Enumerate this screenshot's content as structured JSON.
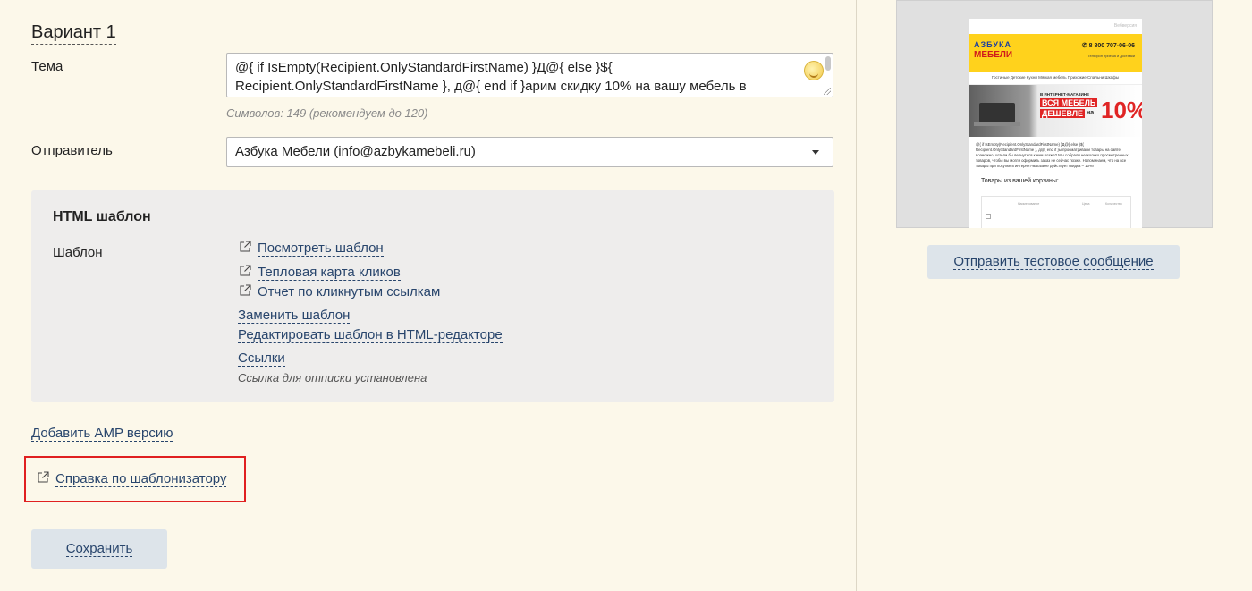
{
  "variant": {
    "title": "Вариант 1"
  },
  "subject": {
    "label": "Тема",
    "value": "@{ if IsEmpty(Recipient.OnlyStandardFirstName) }Д@{ else }${ Recipient.OnlyStandardFirstName }, д@{ end if }арим скидку 10% на вашу мебель в",
    "char_count": "Символов: 149 (рекомендуем до 120)"
  },
  "sender": {
    "label": "Отправитель",
    "value": "Азбука Мебели (info@azbykamebeli.ru)"
  },
  "html_template": {
    "title": "HTML шаблон",
    "template_label": "Шаблон",
    "view_template": "Посмотреть шаблон",
    "heatmap": "Тепловая карта кликов",
    "clicks_report": "Отчет по кликнутым ссылкам",
    "replace_template": "Заменить шаблон",
    "edit_in_html_editor": "Редактировать шаблон в HTML-редакторе",
    "links": "Ссылки",
    "unsubscribe_note": "Ссылка для отписки установлена"
  },
  "add_amp": "Добавить AMP версию",
  "help_link": "Справка по шаблонизатору",
  "save_button": "Сохранить",
  "preview": {
    "topline": "Вебверсия",
    "logo_line1": "АЗБУКА",
    "logo_line2": "МЕБЕЛИ",
    "phone": "8 800 707-06-06",
    "phone_sub": "Телефон приема и доставки",
    "menu": "Гостиные   Детские   Кухни   Мягкая мебель   Прихожие   Спальни   Шкафы",
    "banner_line1": "В ИНТЕРНЕТ-МАГАЗИНЕ",
    "banner_line2": "ВСЯ МЕБЕЛЬ",
    "banner_line3": "ДЕШЕВЛЕ",
    "banner_na": "на",
    "banner_percent": "10%",
    "body_text": "@{ if IsEmpty(Recipient.OnlyStandardFirstName) }Д@{ else }${ Recipient.OnlyStandardFirstName }, д@{ end if }ы просматривали товары на сайте, возможно, хотели бы вернуться к ним позже? Мы собрали несколько просмотренных товаров, чтобы вы могли оформить заказ не сейчас позже. Напоминаем, что на все товары при покупке в интернет-магазине действует скидка – 10%!",
    "cart_title": "Товары из вашей корзины:",
    "col_name": "Наименование",
    "col_price": "Цена",
    "col_qty": "Количество"
  },
  "send_test_button": "Отправить тестовое сообщение"
}
